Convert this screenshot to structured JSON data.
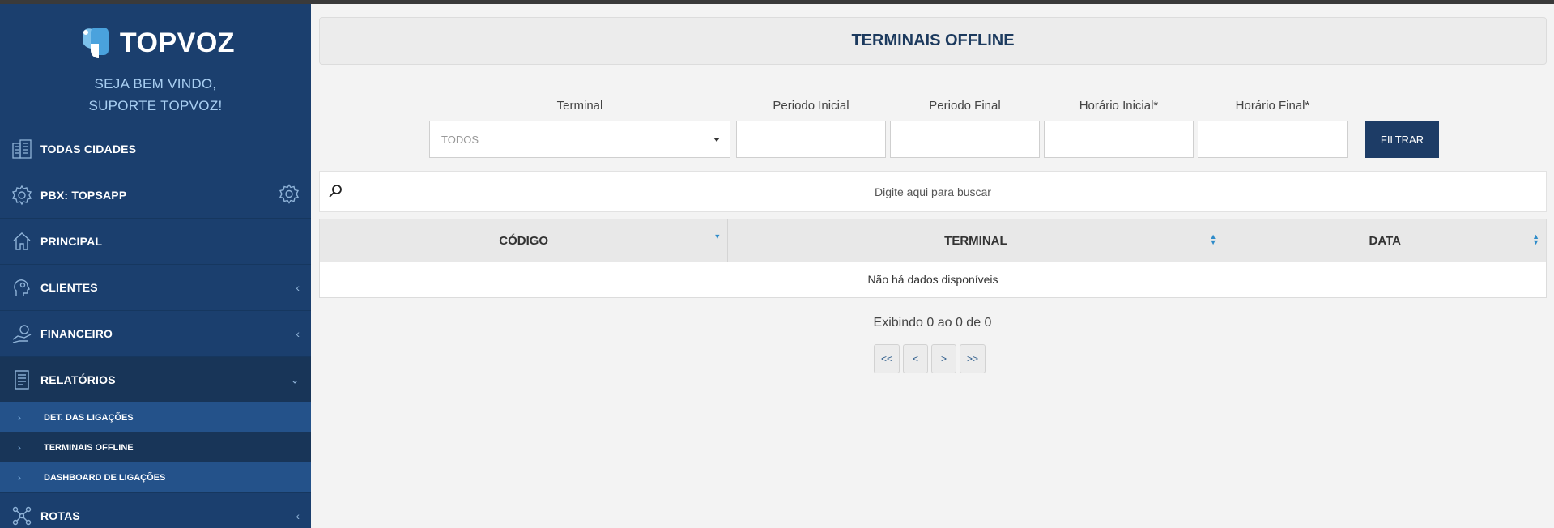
{
  "brand": {
    "name": "TOPVOZ",
    "welcome_line1": "SEJA BEM VINDO,",
    "welcome_line2": "SUPORTE TOPVOZ!"
  },
  "sidebar": {
    "items": [
      {
        "label": "TODAS CIDADES",
        "icon": "building-icon"
      },
      {
        "label": "PBX: TOPSAPP",
        "icon": "gear-icon"
      },
      {
        "label": "PRINCIPAL",
        "icon": "home-icon"
      },
      {
        "label": "CLIENTES",
        "icon": "user-gear-icon"
      },
      {
        "label": "FINANCEIRO",
        "icon": "money-hand-icon"
      },
      {
        "label": "RELATÓRIOS",
        "icon": "report-icon"
      },
      {
        "label": "ROTAS",
        "icon": "network-icon"
      }
    ],
    "subitems": [
      {
        "label": "DET. DAS LIGAÇÕES"
      },
      {
        "label": "TERMINAIS OFFLINE"
      },
      {
        "label": "DASHBOARD DE LIGAÇÕES"
      }
    ]
  },
  "page": {
    "title": "TERMINAIS OFFLINE"
  },
  "filters": {
    "terminal_label": "Terminal",
    "terminal_value": "TODOS",
    "periodo_inicial_label": "Periodo Inicial",
    "periodo_final_label": "Periodo Final",
    "horario_inicial_label": "Horário Inicial*",
    "horario_final_label": "Horário Final*",
    "filter_button": "FILTRAR"
  },
  "search": {
    "placeholder": "Digite aqui para buscar"
  },
  "table": {
    "columns": [
      "CÓDIGO",
      "TERMINAL",
      "DATA"
    ],
    "empty_message": "Não há dados disponíveis"
  },
  "pagination": {
    "info": "Exibindo 0 ao 0 de 0",
    "first": "<<",
    "prev": "<",
    "next": ">",
    "last": ">>"
  },
  "colors": {
    "sidebar": "#1b3f6e",
    "accent": "#1d3c66",
    "sort": "#2e8bc9"
  }
}
